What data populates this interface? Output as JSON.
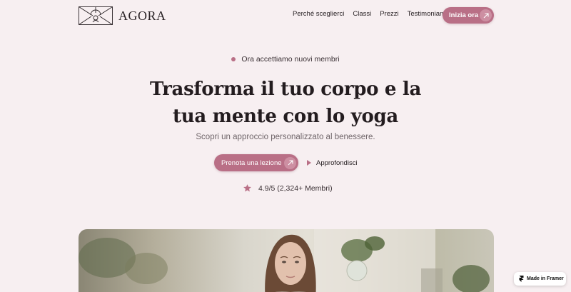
{
  "brand": {
    "name": "AGORA"
  },
  "nav": {
    "items": [
      {
        "label": "Perché sceglierci"
      },
      {
        "label": "Classi"
      },
      {
        "label": "Prezzi"
      },
      {
        "label": "Testimonianze"
      }
    ],
    "cta_label": "Inizia ora"
  },
  "hero": {
    "badge_text": "Ora accettiamo nuovi membri",
    "title_line1": "Trasforma il tuo corpo e la",
    "title_line2": "tua mente con lo yoga",
    "subtitle": "Scopri un approccio personalizzato al benessere.",
    "primary_button": "Prenota una lezione",
    "secondary_button": "Approfondisci",
    "rating_text": "4.9/5 (2,324+ Membri)"
  },
  "framer_badge": {
    "label": "Made in Framer"
  },
  "colors": {
    "background": "#f7eff1",
    "accent": "#b96f86",
    "accent_light": "#cd8fa2",
    "text": "#231c1f"
  },
  "icons": [
    "logo-mark-icon",
    "arrow-up-right-icon",
    "play-icon",
    "star-icon",
    "framer-icon"
  ]
}
